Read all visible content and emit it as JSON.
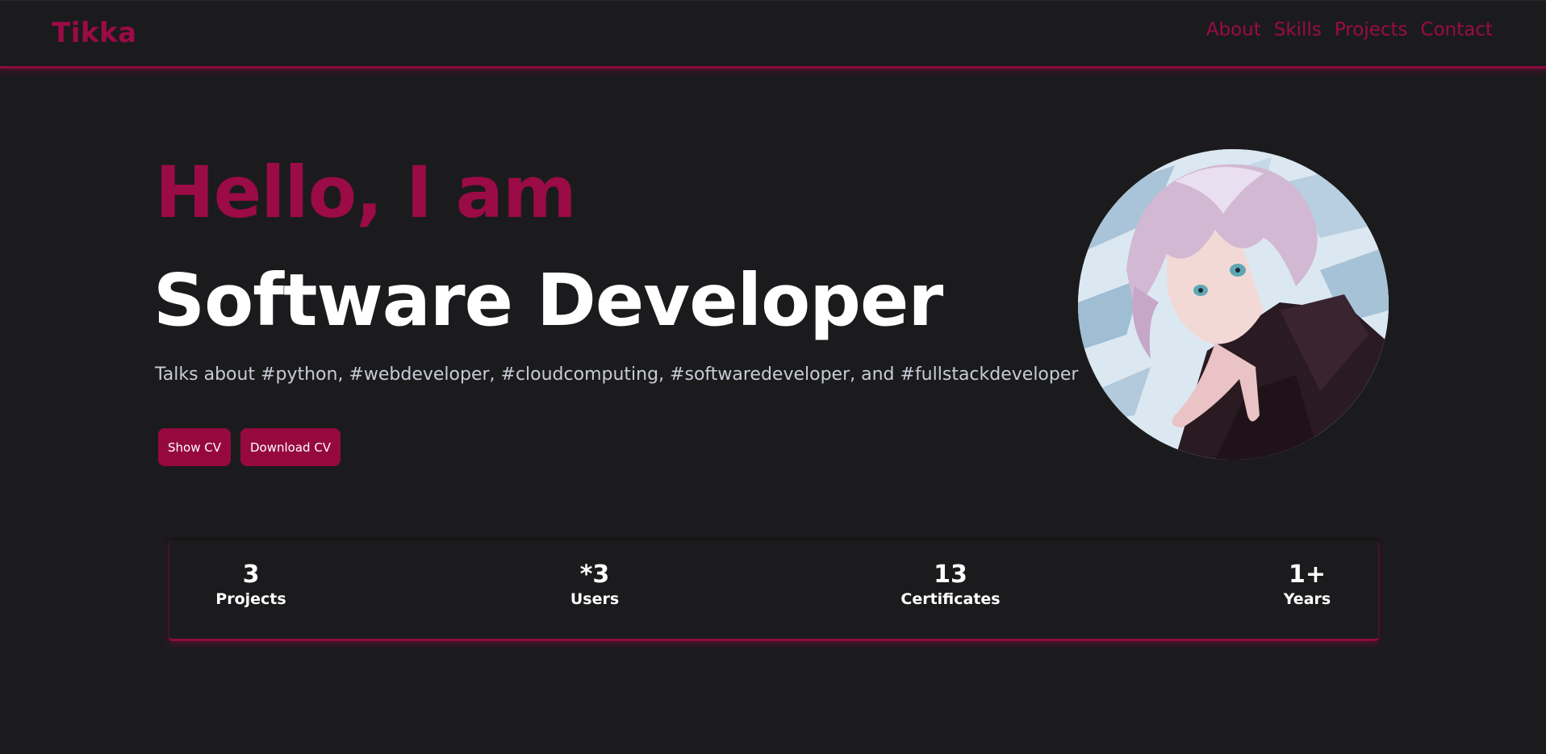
{
  "header": {
    "logo": "Tikka",
    "nav": [
      {
        "label": "About"
      },
      {
        "label": "Skills"
      },
      {
        "label": "Projects"
      },
      {
        "label": "Contact"
      }
    ]
  },
  "hero": {
    "greeting": "Hello, I am",
    "role": "Software Developer",
    "tagline": "Talks about #python, #webdeveloper, #cloudcomputing, #softwaredeveloper, and #fullstackdeveloper",
    "buttons": {
      "show_cv": "Show CV",
      "download_cv": "Download CV"
    },
    "avatar_icon": "anime-portrait"
  },
  "stats": [
    {
      "value": "3",
      "label": "Projects"
    },
    {
      "value": "*3",
      "label": "Users"
    },
    {
      "value": "13",
      "label": "Certificates"
    },
    {
      "value": "1+",
      "label": "Years"
    }
  ],
  "colors": {
    "accent": "#9b0b46",
    "background": "#1b1b1d",
    "text": "#ffffff"
  }
}
